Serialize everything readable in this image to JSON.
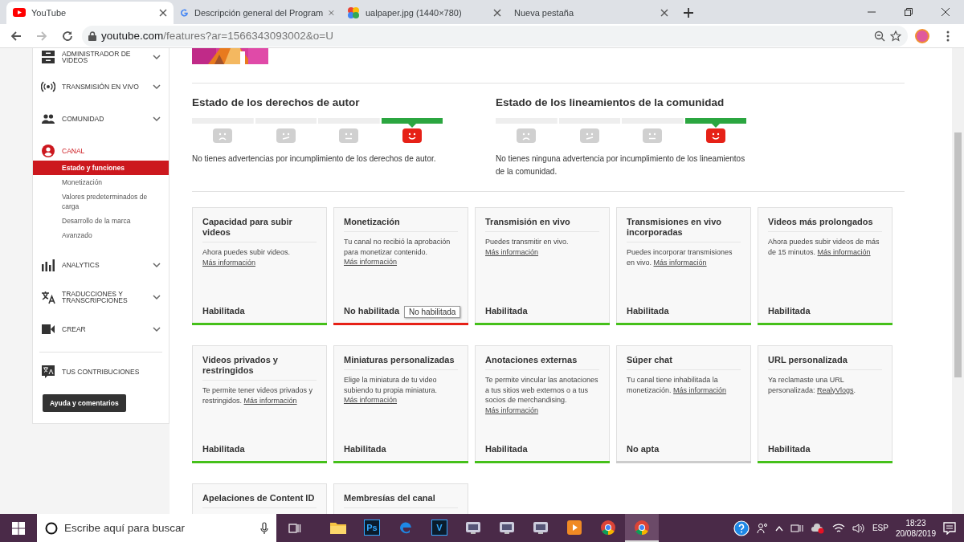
{
  "browser": {
    "tabs": [
      {
        "title": "YouTube",
        "kind": "youtube",
        "selected": true
      },
      {
        "title": "Descripción general del Program",
        "kind": "google",
        "selected": false
      },
      {
        "title": "ualpaper.jpg (1440×780)",
        "kind": "photos",
        "selected": false
      },
      {
        "title": "Nueva pestaña",
        "selected": false
      }
    ],
    "url_host": "youtube.com",
    "url_path": "/features?ar=1566343093002&o=U"
  },
  "sidebar": {
    "items": [
      {
        "label": "ADMINISTRADOR DE VIDEOS",
        "kind": "manager",
        "selected": false,
        "expanded": false
      },
      {
        "label": "TRANSMISIÓN EN VIVO",
        "kind": "live",
        "selected": false,
        "expanded": false
      },
      {
        "label": "COMUNIDAD",
        "kind": "people",
        "selected": false,
        "expanded": false
      },
      {
        "label": "CANAL",
        "kind": "account",
        "selected": true,
        "expanded": true,
        "children": [
          {
            "label": "Estado y funciones",
            "selected": true
          },
          {
            "label": "Monetización",
            "selected": false
          },
          {
            "label": "Valores predeterminados de carga",
            "selected": false
          },
          {
            "label": "Desarrollo de la marca",
            "selected": false
          },
          {
            "label": "Avanzado",
            "selected": false
          }
        ]
      },
      {
        "label": "ANALYTICS",
        "kind": "bars",
        "selected": false,
        "expanded": false
      },
      {
        "label": "TRADUCCIONES Y TRANSCRIPCIONES",
        "kind": "translate",
        "selected": false,
        "expanded": false
      },
      {
        "label": "CREAR",
        "kind": "camera",
        "selected": false,
        "expanded": false
      }
    ],
    "contributions": "TUS CONTRIBUCIONES",
    "help_button": "Ayuda y comentarios"
  },
  "status_panels": [
    {
      "title": "Estado de los derechos de autor",
      "faces": [
        {
          "kind": "sad",
          "selected": false
        },
        {
          "kind": "skeptical",
          "selected": false
        },
        {
          "kind": "neutral",
          "selected": false
        },
        {
          "kind": "happy",
          "selected": true
        }
      ],
      "message": "No tienes advertencias por incumplimiento de los derechos de autor."
    },
    {
      "title": "Estado de los lineamientos de la comunidad",
      "faces": [
        {
          "kind": "sad",
          "selected": false
        },
        {
          "kind": "skeptical",
          "selected": false
        },
        {
          "kind": "neutral",
          "selected": false
        },
        {
          "kind": "happy",
          "selected": true
        }
      ],
      "message": "No tienes ninguna advertencia por incumplimiento de los lineamientos de la comunidad."
    }
  ],
  "features": [
    {
      "title": "Capacidad para subir videos",
      "text": "Ahora puedes subir videos.",
      "link": "Más información",
      "status": "Habilitada",
      "kind": "enabled"
    },
    {
      "title": "Monetización",
      "text": "Tu canal no recibió la aprobación para monetizar contenido.",
      "link": "Más información",
      "status": "No habilitada",
      "kind": "disabled",
      "tooltip": "No habilitada"
    },
    {
      "title": "Transmisión en vivo",
      "text": "Puedes transmitir en vivo.",
      "link": "Más información",
      "status": "Habilitada",
      "kind": "enabled"
    },
    {
      "title": "Transmisiones en vivo incorporadas",
      "text": "Puedes incorporar transmisiones en vivo.",
      "link": "Más información",
      "status": "Habilitada",
      "kind": "enabled"
    },
    {
      "title": "Videos más prolongados",
      "text": "Ahora puedes subir videos de más de 15 minutos.",
      "link": "Más información",
      "status": "Habilitada",
      "kind": "enabled"
    },
    {
      "title": "Videos privados y restringidos",
      "text": "Te permite tener videos privados y restringidos.",
      "link": "Más información",
      "status": "Habilitada",
      "kind": "enabled"
    },
    {
      "title": "Miniaturas personalizadas",
      "text": "Elige la miniatura de tu video subiendo tu propia miniatura.",
      "link": "Más información",
      "status": "Habilitada",
      "kind": "enabled"
    },
    {
      "title": "Anotaciones externas",
      "text": "Te permite vincular las anotaciones a tus sitios web externos o a tus socios de merchandising.",
      "link": "Más información",
      "status": "Habilitada",
      "kind": "enabled"
    },
    {
      "title": "Súper chat",
      "text": "Tu canal tiene inhabilitada la monetización.",
      "link": "Más información",
      "status": "No apta",
      "kind": "ineligible"
    },
    {
      "title": "URL personalizada",
      "text": "Ya reclamaste una URL personalizada:",
      "link": "RealyVlogs",
      "after": ".",
      "status": "Habilitada",
      "kind": "enabled"
    },
    {
      "title": "Apelaciones de Content ID"
    },
    {
      "title": "Membresías del canal"
    }
  ],
  "taskbar": {
    "search_placeholder": "Escribe aquí para buscar",
    "apps": [
      {
        "kind": "folder",
        "selected": false
      },
      {
        "kind": "letter",
        "label": "Ps",
        "selected": false
      },
      {
        "kind": "edge",
        "selected": false
      },
      {
        "kind": "letter",
        "label": "V",
        "selected": false
      },
      {
        "kind": "app",
        "selected": false
      },
      {
        "kind": "app",
        "selected": false
      },
      {
        "kind": "app",
        "selected": false
      },
      {
        "kind": "player",
        "selected": false
      },
      {
        "kind": "chrome",
        "selected": false
      },
      {
        "kind": "chrome",
        "selected": true
      }
    ],
    "language": "ESP",
    "time": "18:23",
    "date": "20/08/2019"
  }
}
